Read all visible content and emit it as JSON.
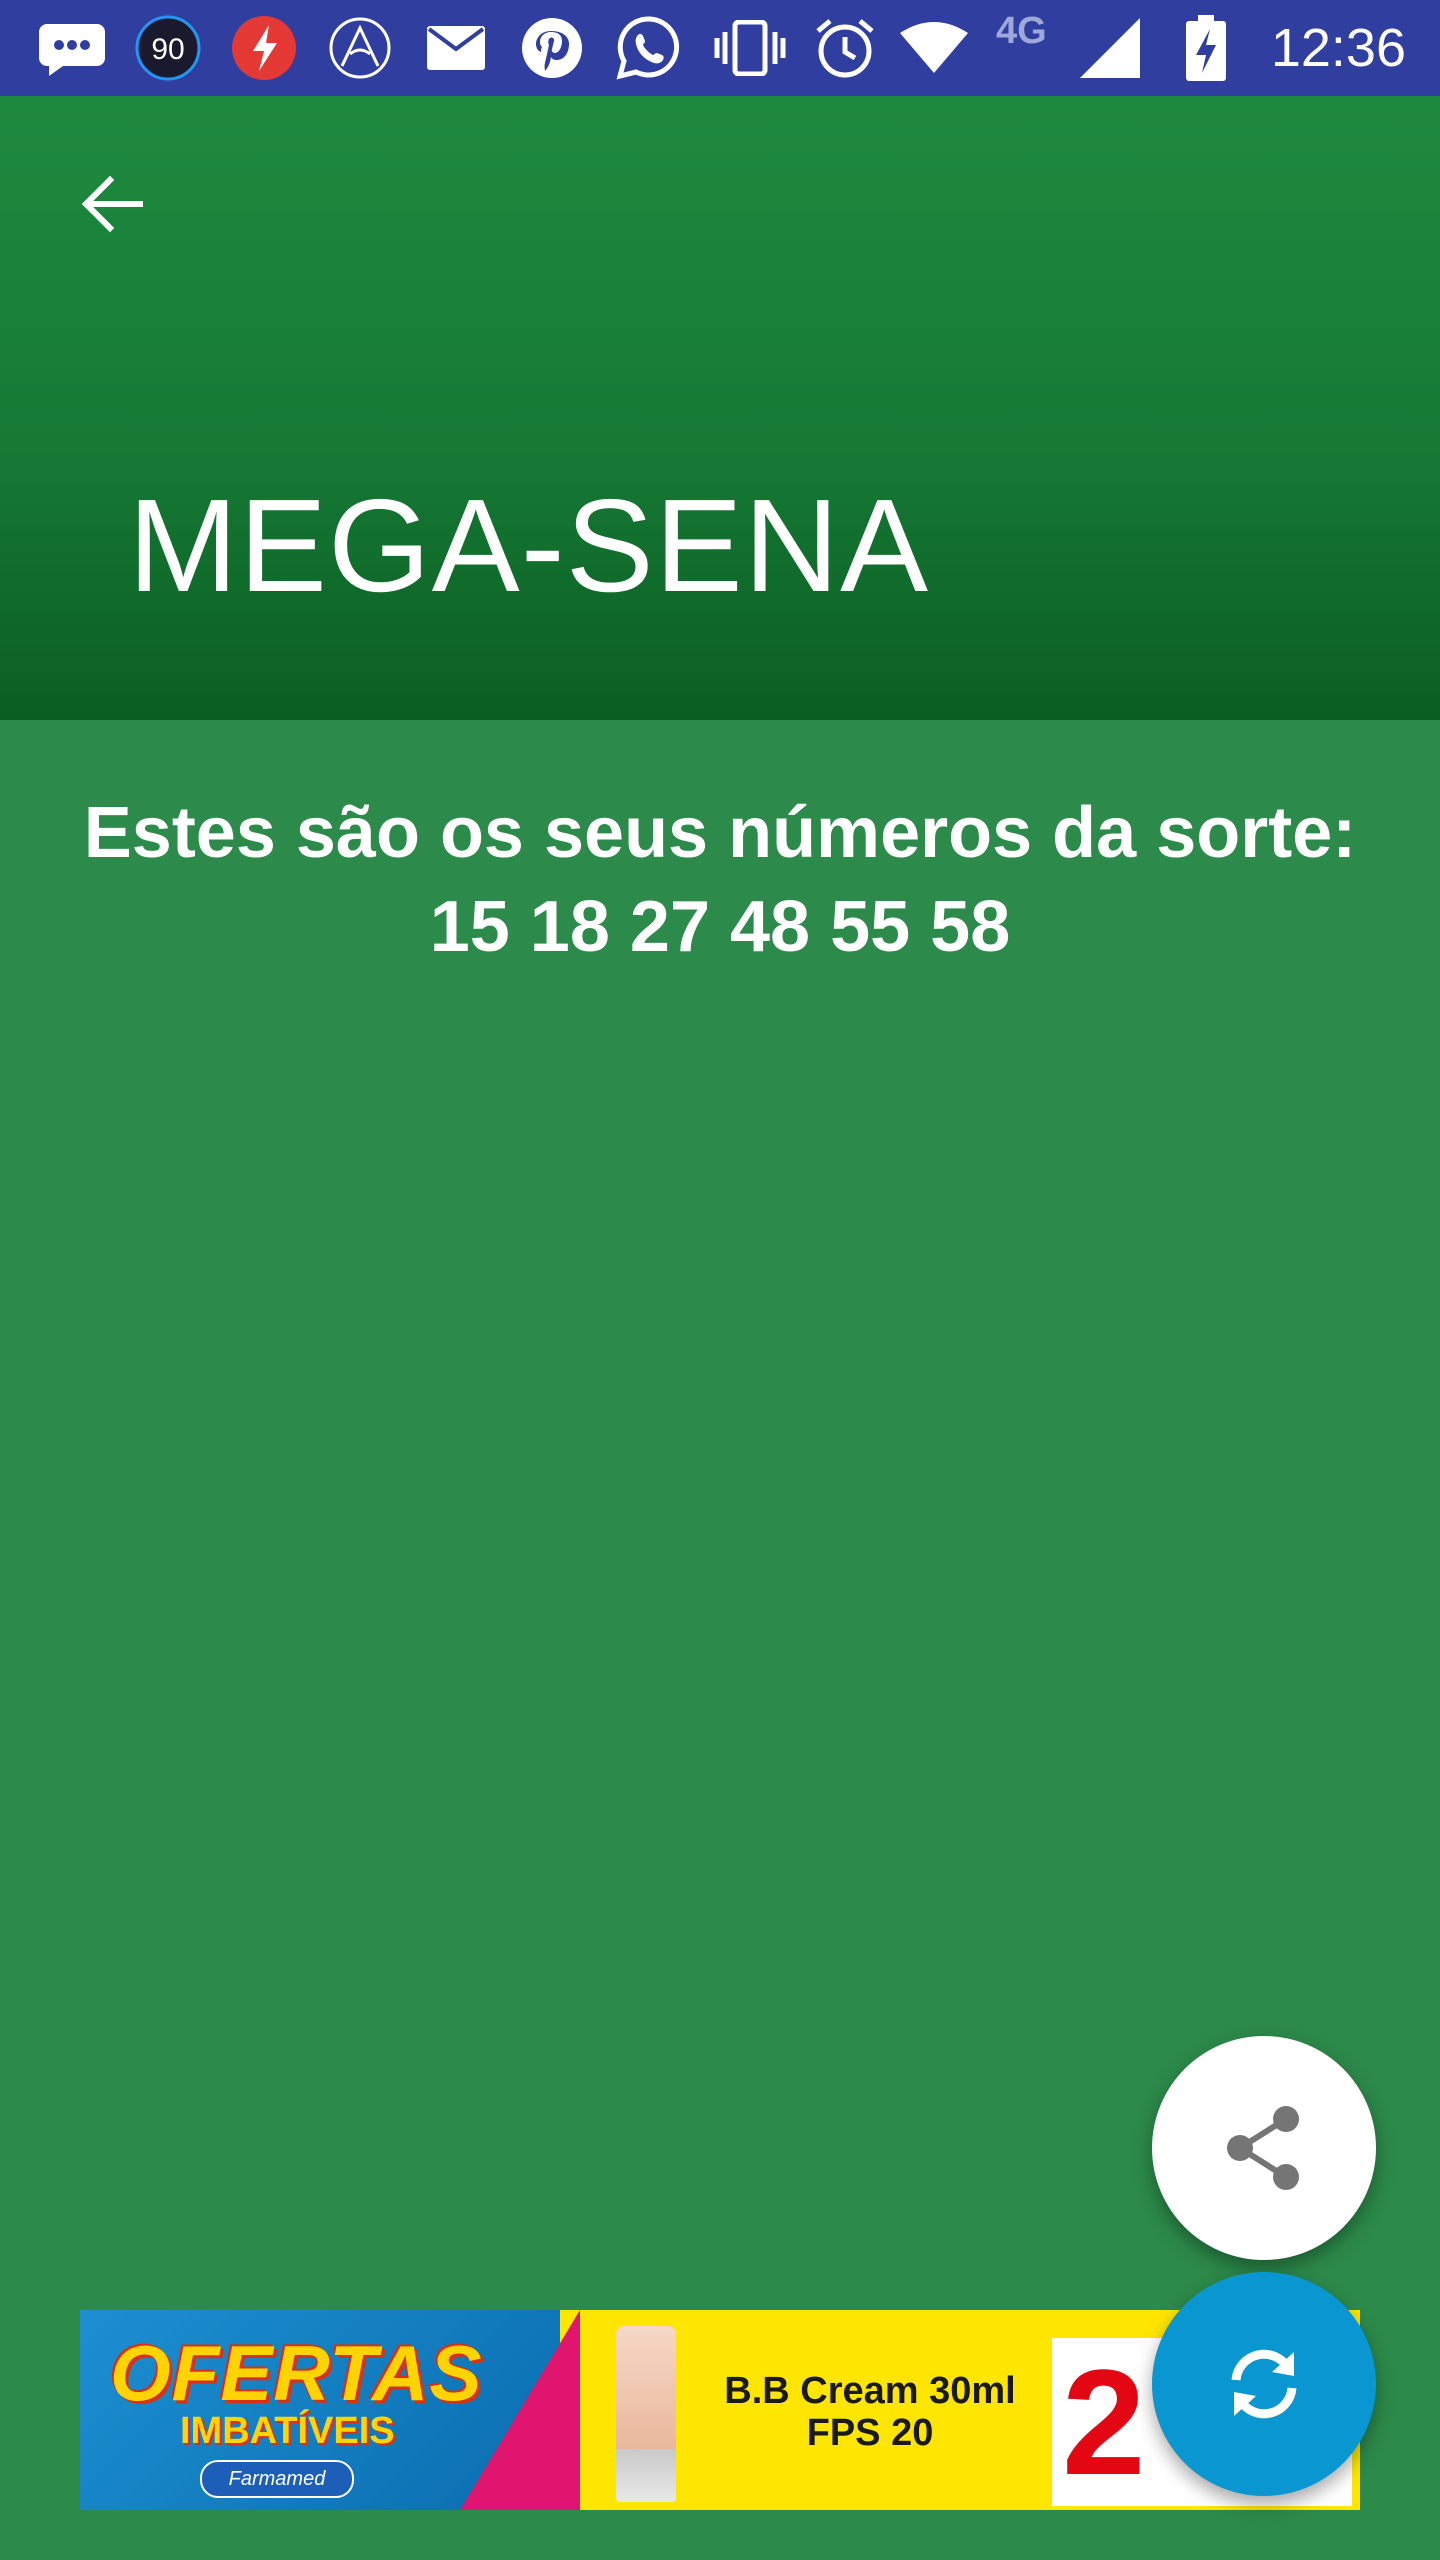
{
  "status_bar": {
    "time": "12:36",
    "badge_count": "90",
    "network": "4G",
    "icons": [
      "messenger-icon",
      "badge-90-icon",
      "flash-app-icon",
      "arrow-app-icon",
      "mail-icon",
      "pinterest-icon",
      "whatsapp-icon",
      "vibrate-icon",
      "alarm-icon",
      "wifi-icon",
      "signal-icon",
      "battery-charging-icon"
    ]
  },
  "app_bar": {
    "title": "MEGA-SENA",
    "back_icon": "arrow-back-icon"
  },
  "content": {
    "message": "Estes são os seus números da sorte:",
    "numbers": "15 18 27 48 55 58"
  },
  "fabs": {
    "share_icon": "share-icon",
    "refresh_icon": "refresh-icon"
  },
  "ad": {
    "headline": "OFERTAS",
    "subheadline": "IMBATÍVEIS",
    "brand": "Farmamed",
    "product_line1": "B.B Cream 30ml",
    "product_line2": "FPS 20",
    "price": "2"
  },
  "colors": {
    "status_bar": "#303f9f",
    "background": "#2c8a4a",
    "app_bar_dark": "#0b5e22",
    "fab_refresh": "#0a96d0",
    "ad_yellow": "#ffe600"
  }
}
